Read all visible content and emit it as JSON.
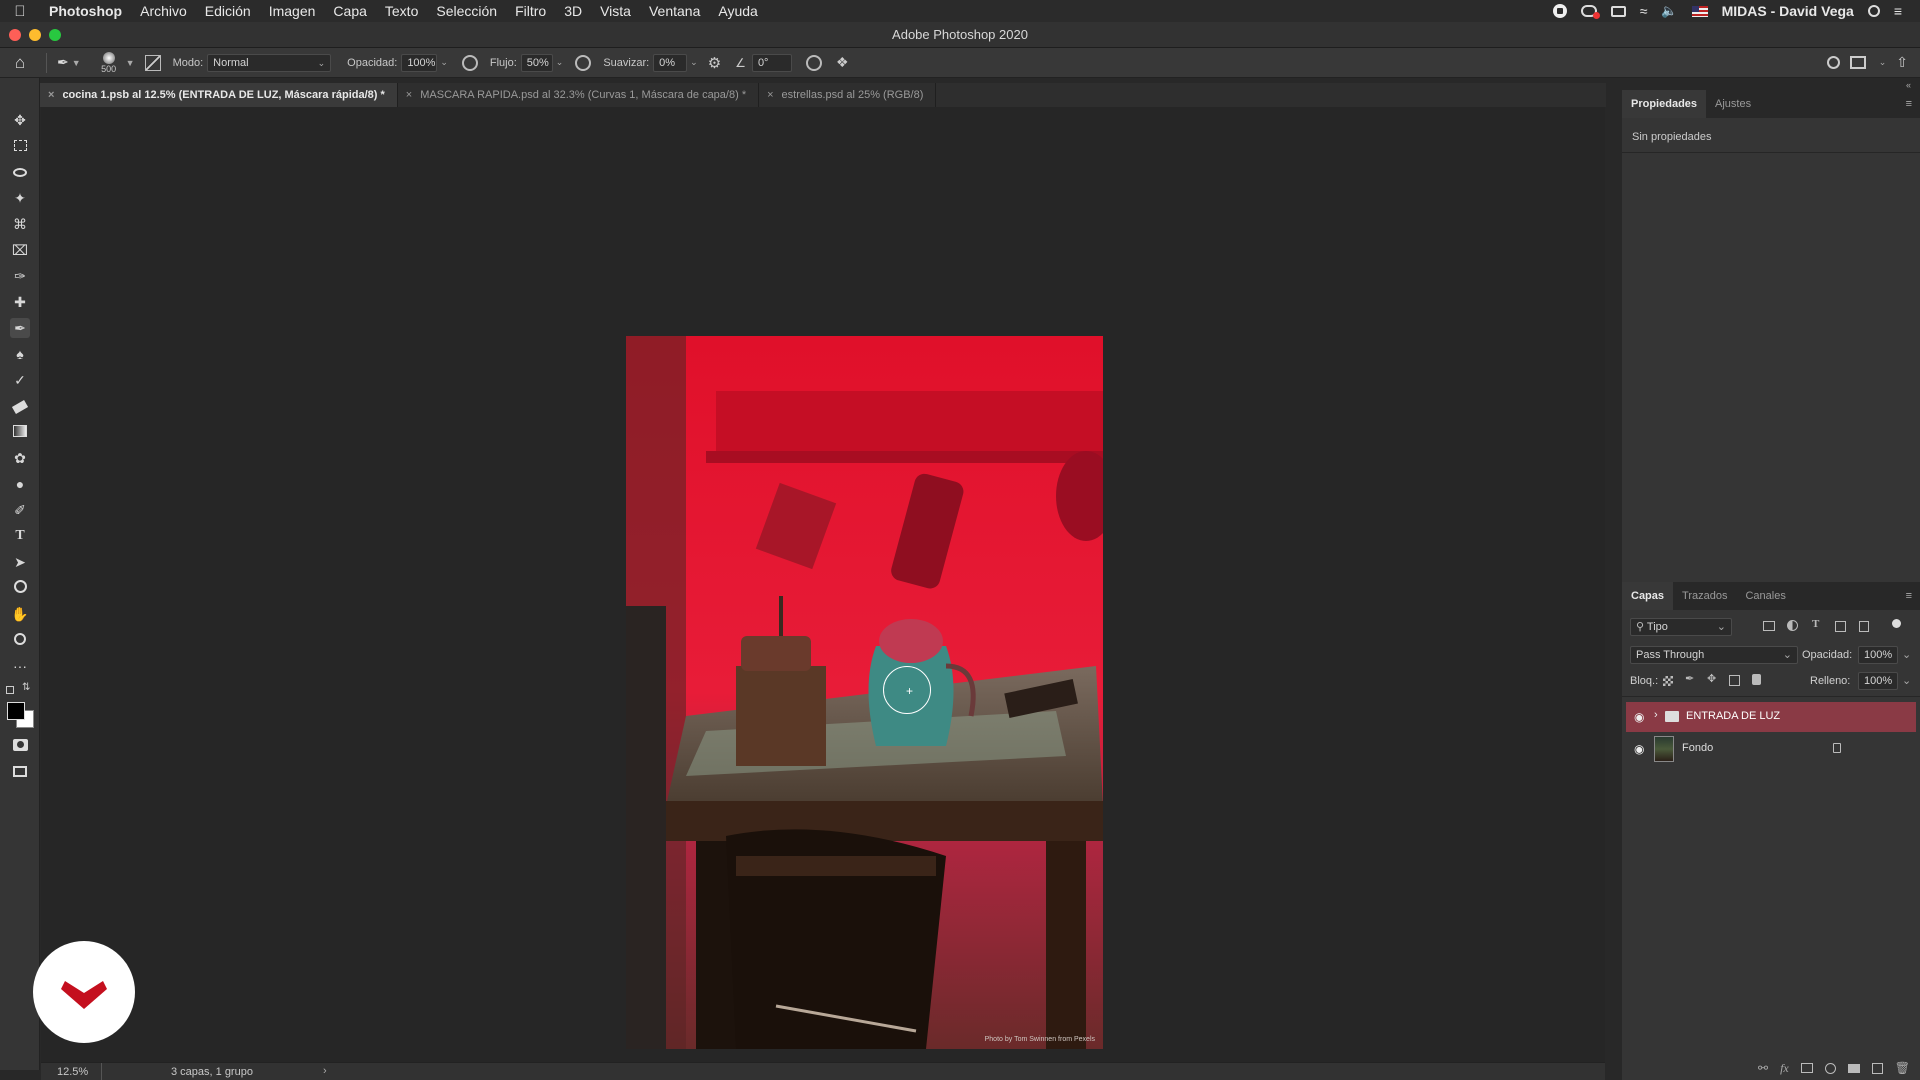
{
  "menubar": {
    "items": [
      "Photoshop",
      "Archivo",
      "Edición",
      "Imagen",
      "Capa",
      "Texto",
      "Selección",
      "Filtro",
      "3D",
      "Vista",
      "Ventana",
      "Ayuda"
    ],
    "user": "MIDAS - David Vega"
  },
  "window": {
    "title": "Adobe Photoshop 2020"
  },
  "options": {
    "brush_size": "500",
    "mode_label": "Modo:",
    "mode_value": "Normal",
    "opacity_label": "Opacidad:",
    "opacity_value": "100%",
    "flow_label": "Flujo:",
    "flow_value": "50%",
    "smooth_label": "Suavizar:",
    "smooth_value": "0%",
    "angle_value": "0°"
  },
  "tabs": [
    {
      "label": "cocina 1.psb al 12.5% (ENTRADA DE LUZ, Máscara rápida/8) *"
    },
    {
      "label": "MASCARA RAPIDA.psd al 32.3% (Curvas 1, Máscara de capa/8) *"
    },
    {
      "label": "estrellas.psd al 25% (RGB/8)"
    }
  ],
  "document": {
    "credit": "Photo by Tom Swinnen from Pexels"
  },
  "properties": {
    "tabs": [
      "Propiedades",
      "Ajustes"
    ],
    "empty_text": "Sin propiedades"
  },
  "layers_panel": {
    "tabs": [
      "Capas",
      "Trazados",
      "Canales"
    ],
    "filter_label": "Tipo",
    "blend_mode": "Pass Through",
    "opacity_label": "Opacidad:",
    "opacity_value": "100%",
    "lock_label": "Bloq.:",
    "fill_label": "Relleno:",
    "fill_value": "100%",
    "layers": [
      {
        "name": "ENTRADA DE LUZ",
        "type": "group",
        "selected": true
      },
      {
        "name": "Fondo",
        "type": "image",
        "locked": true
      }
    ]
  },
  "status": {
    "zoom": "12.5%",
    "info": "3 capas, 1 grupo"
  },
  "colors": {
    "quickmask": "#e0102a",
    "selected_layer": "#8a3a45",
    "logo": "#c40f1e"
  }
}
